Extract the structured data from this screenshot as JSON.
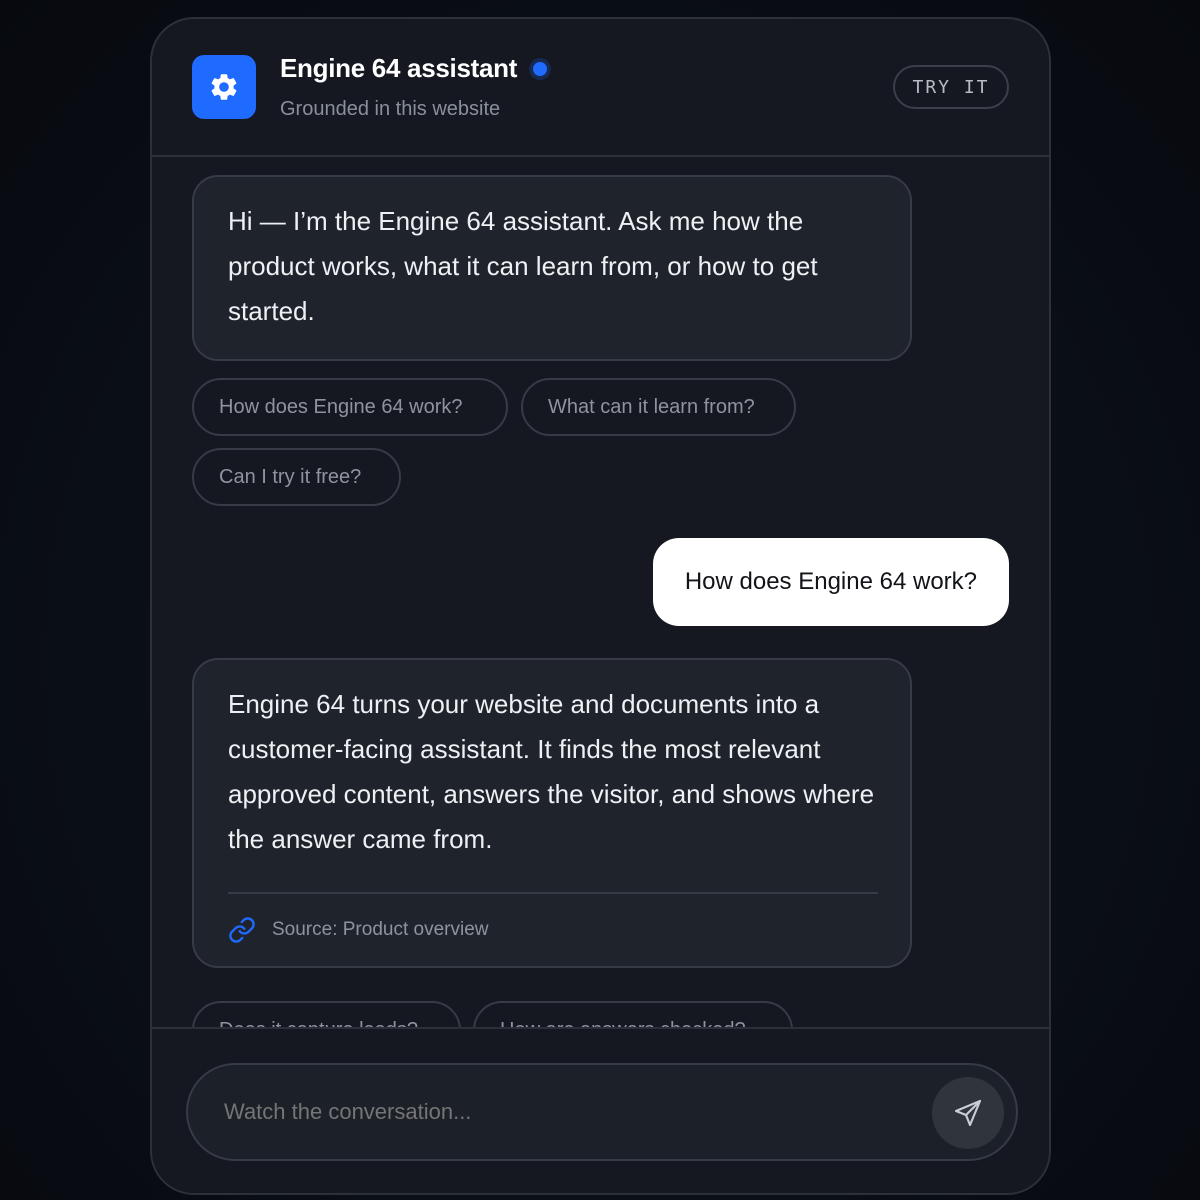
{
  "header": {
    "title": "Engine 64 assistant",
    "subtitle": "Grounded in this website",
    "try_label": "TRY IT",
    "app_icon": "gear-icon",
    "status_color": "#1f6bff"
  },
  "messages": {
    "greeting": "Hi — I’m the Engine 64 assistant. Ask me how the product works, what it can learn from, or how to get started.",
    "suggestions_1": [
      "How does Engine 64 work?",
      "What can it learn from?",
      "Can I try it free?"
    ],
    "user_question": "How does Engine 64 work?",
    "answer": "Engine 64 turns your website and documents into a customer-facing assistant. It finds the most relevant approved content, answers the visitor, and shows where the answer came from.",
    "source_label": "Source: Product overview",
    "source_icon": "link-icon",
    "suggestions_2": [
      "Does it capture leads?",
      "How are answers checked?"
    ]
  },
  "composer": {
    "placeholder": "Watch the conversation...",
    "send_icon": "send-icon"
  },
  "colors": {
    "accent": "#1f6bff",
    "panel_bg": "#151820",
    "bubble_bg": "#1f232c",
    "user_bubble_bg": "#ffffff"
  }
}
